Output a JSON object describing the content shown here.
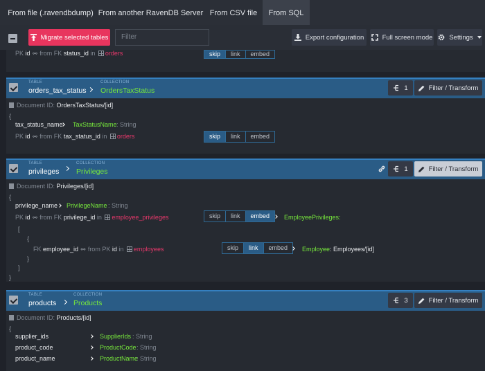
{
  "tabs": [
    "From file (.ravendbdump)",
    "From another RavenDB Server",
    "From CSV file",
    "From SQL"
  ],
  "active_tab": "From SQL",
  "toolbar": {
    "migrate_label": "Migrate selected tables",
    "filter_placeholder": "Filter",
    "export_label": "Export configuration",
    "fullscreen_label": "Full screen mode",
    "settings_label": "Settings"
  },
  "common": {
    "table_caption": "TABLE",
    "collection_caption": "COLLECTION",
    "filter_transform": "Filter / Transform",
    "pk": "PK",
    "fk": "FK",
    "from": "from",
    "in": "in",
    "id": "id",
    "string_type": ": String",
    "doc_id_label": "Document ID:",
    "skip": "skip",
    "link": "link",
    "embed": "embed",
    "brace_open": "{",
    "brace_close": "}",
    "bracket_open": "[",
    "bracket_close": "]"
  },
  "partial": {
    "fk_field": "status_id",
    "target": "orders"
  },
  "tables": [
    {
      "table": "orders_tax_status",
      "collection": "OrdersTaxStatus",
      "count": "1",
      "doc_id": "OrdersTaxStatus/[id]",
      "column": "tax_status_name",
      "property": "TaxStatusName",
      "fk_field": "tax_status_id",
      "target": "orders"
    },
    {
      "table": "privileges",
      "collection": "Privileges",
      "count": "1",
      "doc_id": "Privileges/[id]",
      "column": "privilege_name",
      "property": "PrivilegeName",
      "fk_field": "privilege_id",
      "target": "employee_privileges",
      "embed_property": "EmployeePrivileges:",
      "nested": {
        "fk_field": "employee_id",
        "target": "employees",
        "property": "Employee",
        "value": ": Employees/[id]"
      }
    },
    {
      "table": "products",
      "collection": "Products",
      "count": "3",
      "doc_id": "Products/[id]",
      "columns": [
        {
          "column": "supplier_ids",
          "property": "SupplierIds"
        },
        {
          "column": "product_code",
          "property": "ProductCode"
        },
        {
          "column": "product_name",
          "property": "ProductName"
        }
      ]
    }
  ],
  "colors": {
    "accent": "#2a5c86",
    "migrate": "#e8355e",
    "collection": "#77e83c",
    "target": "#e8386b"
  }
}
